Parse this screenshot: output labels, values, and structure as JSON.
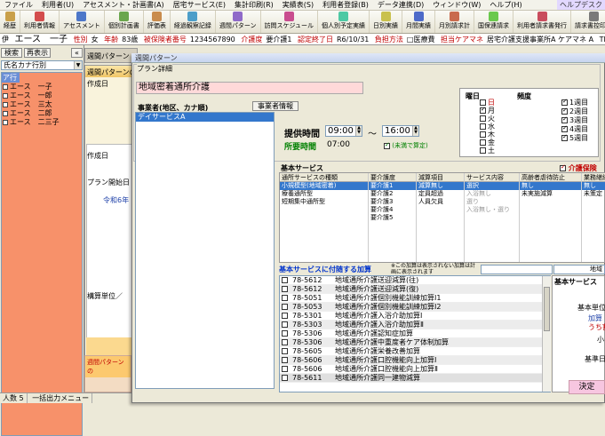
{
  "menu": [
    "ファイル",
    "利用者(U)",
    "アセスメント・計画書(A)",
    "居宅サービス(E)",
    "集計印刷(R)",
    "実績表(S)",
    "利用者登録(B)",
    "データ連携(D)",
    "ウィンドウ(W)",
    "ヘルプ(H)"
  ],
  "help_tag": "ヘルプデスク",
  "toolbar": [
    "経歴",
    "利用者情報",
    "アセスメント",
    "個別計画書",
    "評価表",
    "経過観察記録",
    "週間パターン",
    "訪問スケジュール",
    "個人別予定実績",
    "日別実績",
    "月間実績",
    "月別請求計",
    "国保連請求",
    "利用者請求書発行",
    "請求書控印刷"
  ],
  "toolbar_colors": [
    "#c9a04a",
    "#d34d4d",
    "#4d77c9",
    "#6aa64d",
    "#c98c4d",
    "#4d9ec9",
    "#8f6ac9",
    "#c94d8f",
    "#4dc9a4",
    "#c9c14d",
    "#4d6ac9",
    "#c96a4d",
    "#6ac94d",
    "#c94d5e",
    "#7a7a7a"
  ],
  "info": {
    "left": "伊",
    "name": "エース　一子",
    "gender_lbl": "性別",
    "gender": "女",
    "age_lbl": "年齢",
    "age": "83歳",
    "insured_lbl": "被保険者番号",
    "insured_no": "1234567890",
    "care_lbl": "介護度",
    "care": "要介護1",
    "cert_lbl": "認定終了日",
    "cert_end": "R6/10/31",
    "copay_lbl": "負担方法",
    "copay": "□医療費",
    "cm_lbl": "担当ケアマネ",
    "cm": "居宅介護支援事業所A ケアマネ A",
    "tel": "TEL:111-111"
  },
  "left": {
    "search_btn": "検索",
    "re_search_btn": "再表示",
    "collapse_btn": "«",
    "kana_select": "氏名カナ行別",
    "group_header": "ア行",
    "clients": [
      "エース　一子",
      "エース　一郎",
      "エース　三太",
      "エース　二郎",
      "エース　二三子"
    ],
    "status": [
      "人数 5",
      "一括出力メニュー"
    ]
  },
  "bg": {
    "tab": "週間パターン",
    "title": "週間パターンの",
    "label_a": "作成日",
    "label_b": "プラン開始日",
    "label_c": "令和6年",
    "label_d": "構算単位／",
    "bottom_tab": "週間パターンの"
  },
  "modal": {
    "title": "週間パターン",
    "group_label": "プラン詳細",
    "service_name": "地域密着通所介護",
    "provider_label": "事業者(地区、カナ順)",
    "provider_btn": "事業者情報",
    "providers": [
      "デイサービスA"
    ],
    "time_label": "提供時間",
    "time_from": "09:00",
    "time_to": "16:00",
    "required_label": "所要時間",
    "required_value": "07:00",
    "round_note": "(未満で算定)",
    "weekday_label": "曜日",
    "freq_label": "頻度",
    "weekdays": [
      {
        "d": "日",
        "on": false,
        "red": true
      },
      {
        "d": "月",
        "on": true
      },
      {
        "d": "火",
        "on": false
      },
      {
        "d": "水",
        "on": false
      },
      {
        "d": "木",
        "on": false
      },
      {
        "d": "金",
        "on": false
      },
      {
        "d": "土",
        "on": false
      }
    ],
    "weeks": [
      "1週目",
      "2週目",
      "3週目",
      "4週目",
      "5週目"
    ],
    "basic_label": "基本サービス",
    "care_check": "介護保険",
    "cols": [
      {
        "h": "通所サービスの種類",
        "items": [
          "小規模型(地域密着)",
          "療養通所型",
          "短期集中通所型"
        ]
      },
      {
        "h": "要介護度",
        "items": [
          "要介護1",
          "要介護2",
          "要介護3",
          "要介護4",
          "要介護5"
        ]
      },
      {
        "h": "減算項目",
        "items": [
          "減算無し",
          "定員超過",
          "人員欠員"
        ]
      },
      {
        "h": "サービス内容",
        "items": [
          "選択",
          "入浴無し",
          "選り",
          "入浴無し・選り"
        ]
      },
      {
        "h": "高齢者虐待防止",
        "items": [
          "無し",
          "未実施減算"
        ]
      },
      {
        "h": "業務継続",
        "items": [
          "無し",
          "未策定"
        ]
      }
    ],
    "addon_label": "基本サービスに付随する加算",
    "addon_note": "※この加算は表示されない加算は計画に表示されます",
    "addon_filter": "地域",
    "addons": [
      {
        "code": "78-5612",
        "name": "地域通所介護送迎減算(往)"
      },
      {
        "code": "78-5612",
        "name": "地域通所介護送迎減算(復)"
      },
      {
        "code": "78-5051",
        "name": "地域通所介護個別機能訓練加算Ⅰ1"
      },
      {
        "code": "78-5053",
        "name": "地域通所介護個別機能訓練加算Ⅰ2"
      },
      {
        "code": "78-5301",
        "name": "地域通所介護入浴介助加算Ⅰ"
      },
      {
        "code": "78-5303",
        "name": "地域通所介護入浴介助加算Ⅱ"
      },
      {
        "code": "78-5306",
        "name": "地域通所介護認知症加算"
      },
      {
        "code": "78-5306",
        "name": "地域通所介護中重度者ケア体制加算"
      },
      {
        "code": "78-5605",
        "name": "地域通所介護栄養改善加算"
      },
      {
        "code": "78-5606",
        "name": "地域通所介護口腔機能向上加算Ⅰ"
      },
      {
        "code": "78-5606",
        "name": "地域通所介護口腔機能向上加算Ⅱ"
      },
      {
        "code": "78-5611",
        "name": "地域通所介護同一建物減算"
      }
    ],
    "summary_title": "基本サービス",
    "summary": [
      "基本単位",
      "加算",
      "うち割",
      "小",
      "基準日"
    ],
    "decide_btn": "決定"
  }
}
